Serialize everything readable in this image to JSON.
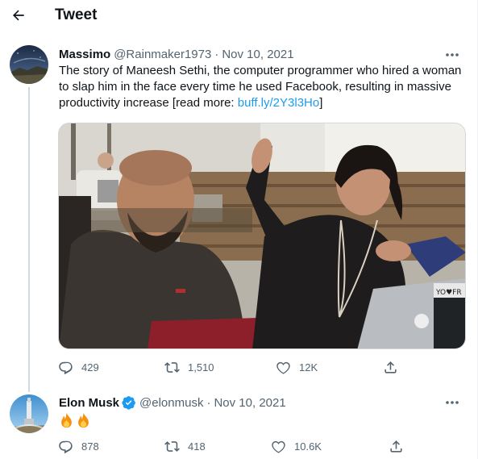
{
  "header": {
    "title": "Tweet",
    "back_icon": "arrow-left-icon"
  },
  "tweets": [
    {
      "author": "Massimo",
      "handle": "@Rainmaker1973",
      "separator": "·",
      "date": "Nov 10, 2021",
      "text": "The story of Maneesh Sethi, the computer programmer who hired a woman to slap him in the face every time he used Facebook, resulting in massive productivity increase [read more: ",
      "link_text": "buff.ly/2Y3l3Ho",
      "text_end": "]",
      "has_media": true,
      "media_sign_text": "YO♥FR",
      "stats": {
        "replies": "429",
        "retweets": "1,510",
        "likes": "12K"
      }
    },
    {
      "author": "Elon Musk",
      "verified": true,
      "handle": "@elonmusk",
      "separator": "·",
      "date": "Nov 10, 2021",
      "text": "🔥🔥",
      "stats": {
        "replies": "878",
        "retweets": "418",
        "likes": "10.6K"
      }
    }
  ],
  "icons": {
    "reply": "reply-icon",
    "retweet": "retweet-icon",
    "like": "heart-icon",
    "share": "share-icon",
    "more": "more-icon",
    "verified": "verified-badge-icon"
  },
  "colors": {
    "text": "#0f1419",
    "secondary": "#536471",
    "link": "#1d9bf0",
    "verified": "#1d9bf0",
    "thread_line": "#cfd9de"
  }
}
